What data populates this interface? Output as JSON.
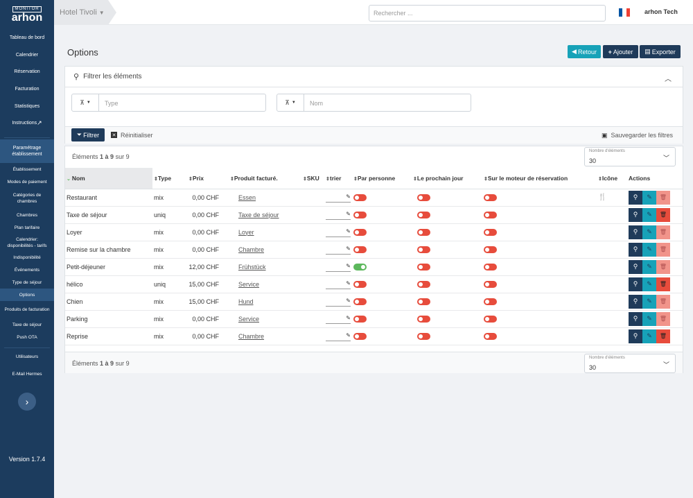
{
  "app": {
    "logo_top": "MONITOR",
    "logo_name": "arhon",
    "version": "Version 1.7.4"
  },
  "sidebar": {
    "items": [
      {
        "label": "Tableau de bord"
      },
      {
        "label": "Calendrier"
      },
      {
        "label": "Réservation"
      },
      {
        "label": "Facturation"
      },
      {
        "label": "Statistiques"
      },
      {
        "label": "Instructions"
      }
    ],
    "section": {
      "label": "Paramétrage établissement"
    },
    "subitems": [
      {
        "label": "Établissement"
      },
      {
        "label": "Modes de paiement"
      },
      {
        "label": "Catégories de chambres"
      },
      {
        "label": "Chambres"
      },
      {
        "label": "Plan tarifaire"
      },
      {
        "label": "Calendrier: disponibilités - tarifs"
      },
      {
        "label": "Indisponibilité"
      },
      {
        "label": "Événements"
      },
      {
        "label": "Type de séjour"
      },
      {
        "label": "Options"
      },
      {
        "label": "Produits de facturation"
      },
      {
        "label": "Taxe de séjour"
      },
      {
        "label": "Push OTA"
      }
    ],
    "bottom": [
      {
        "label": "Utilisateurs"
      },
      {
        "label": "E-Mail Hermes"
      }
    ]
  },
  "topbar": {
    "hotel": "Hotel Tivoli",
    "search_placeholder": "Rechercher ...",
    "user": "arhon Tech"
  },
  "page": {
    "title": "Options",
    "btn_back": "Retour",
    "btn_add": "Ajouter",
    "btn_export": "Exporter"
  },
  "filters": {
    "title": "Filtrer les éléments",
    "type_placeholder": "Type",
    "name_placeholder": "Nom",
    "btn_filter": "Filtrer",
    "btn_reset": "Réinitialiser",
    "btn_save": "Sauvegarder les filtres"
  },
  "table": {
    "count_pre": "Éléments ",
    "count_range": "1 à 9",
    "count_post": " sur 9",
    "per_page_label": "Nombre d'éléments",
    "per_page": "30",
    "columns": [
      "Nom",
      "Type",
      "Prix",
      "Produit facturé.",
      "SKU",
      "trier",
      "Par personne",
      "Le prochain jour",
      "Sur le moteur de réservation",
      "Icône",
      "Actions"
    ],
    "rows": [
      {
        "nom": "Restaurant",
        "type": "mix",
        "prix": "0,00 CHF",
        "produit": "Essen",
        "par_personne": false,
        "prochain": false,
        "moteur": false,
        "icon": "fork-knife-icon",
        "delete_enabled": false
      },
      {
        "nom": "Taxe de séjour",
        "type": "uniq",
        "prix": "0,00 CHF",
        "produit": "Taxe de séjour",
        "par_personne": false,
        "prochain": false,
        "moteur": false,
        "icon": "",
        "delete_enabled": true
      },
      {
        "nom": "Loyer",
        "type": "mix",
        "prix": "0,00 CHF",
        "produit": "Loyer",
        "par_personne": false,
        "prochain": false,
        "moteur": false,
        "icon": "",
        "delete_enabled": false
      },
      {
        "nom": "Remise sur la chambre",
        "type": "mix",
        "prix": "0,00 CHF",
        "produit": "Chambre",
        "par_personne": false,
        "prochain": false,
        "moteur": false,
        "icon": "",
        "delete_enabled": false
      },
      {
        "nom": "Petit-déjeuner",
        "type": "mix",
        "prix": "12,00 CHF",
        "produit": "Frühstück",
        "par_personne": true,
        "prochain": false,
        "moteur": false,
        "icon": "",
        "delete_enabled": false
      },
      {
        "nom": "hélico",
        "type": "uniq",
        "prix": "15,00 CHF",
        "produit": "Service",
        "par_personne": false,
        "prochain": false,
        "moteur": false,
        "icon": "",
        "delete_enabled": true
      },
      {
        "nom": "Chien",
        "type": "mix",
        "prix": "15,00 CHF",
        "produit": "Hund",
        "par_personne": false,
        "prochain": false,
        "moteur": false,
        "icon": "",
        "delete_enabled": false
      },
      {
        "nom": "Parking",
        "type": "mix",
        "prix": "0,00 CHF",
        "produit": "Service",
        "par_personne": false,
        "prochain": false,
        "moteur": false,
        "icon": "",
        "delete_enabled": false
      },
      {
        "nom": "Reprise",
        "type": "mix",
        "prix": "0,00 CHF",
        "produit": "Chambre",
        "par_personne": false,
        "prochain": false,
        "moteur": false,
        "icon": "",
        "delete_enabled": true
      }
    ]
  },
  "colors": {
    "sidebar": "#1c3c5e",
    "teal": "#17a2b8",
    "navy": "#1f3b5a",
    "red": "#e74c3c",
    "red_light": "#f1948a",
    "green": "#5cb85c"
  }
}
